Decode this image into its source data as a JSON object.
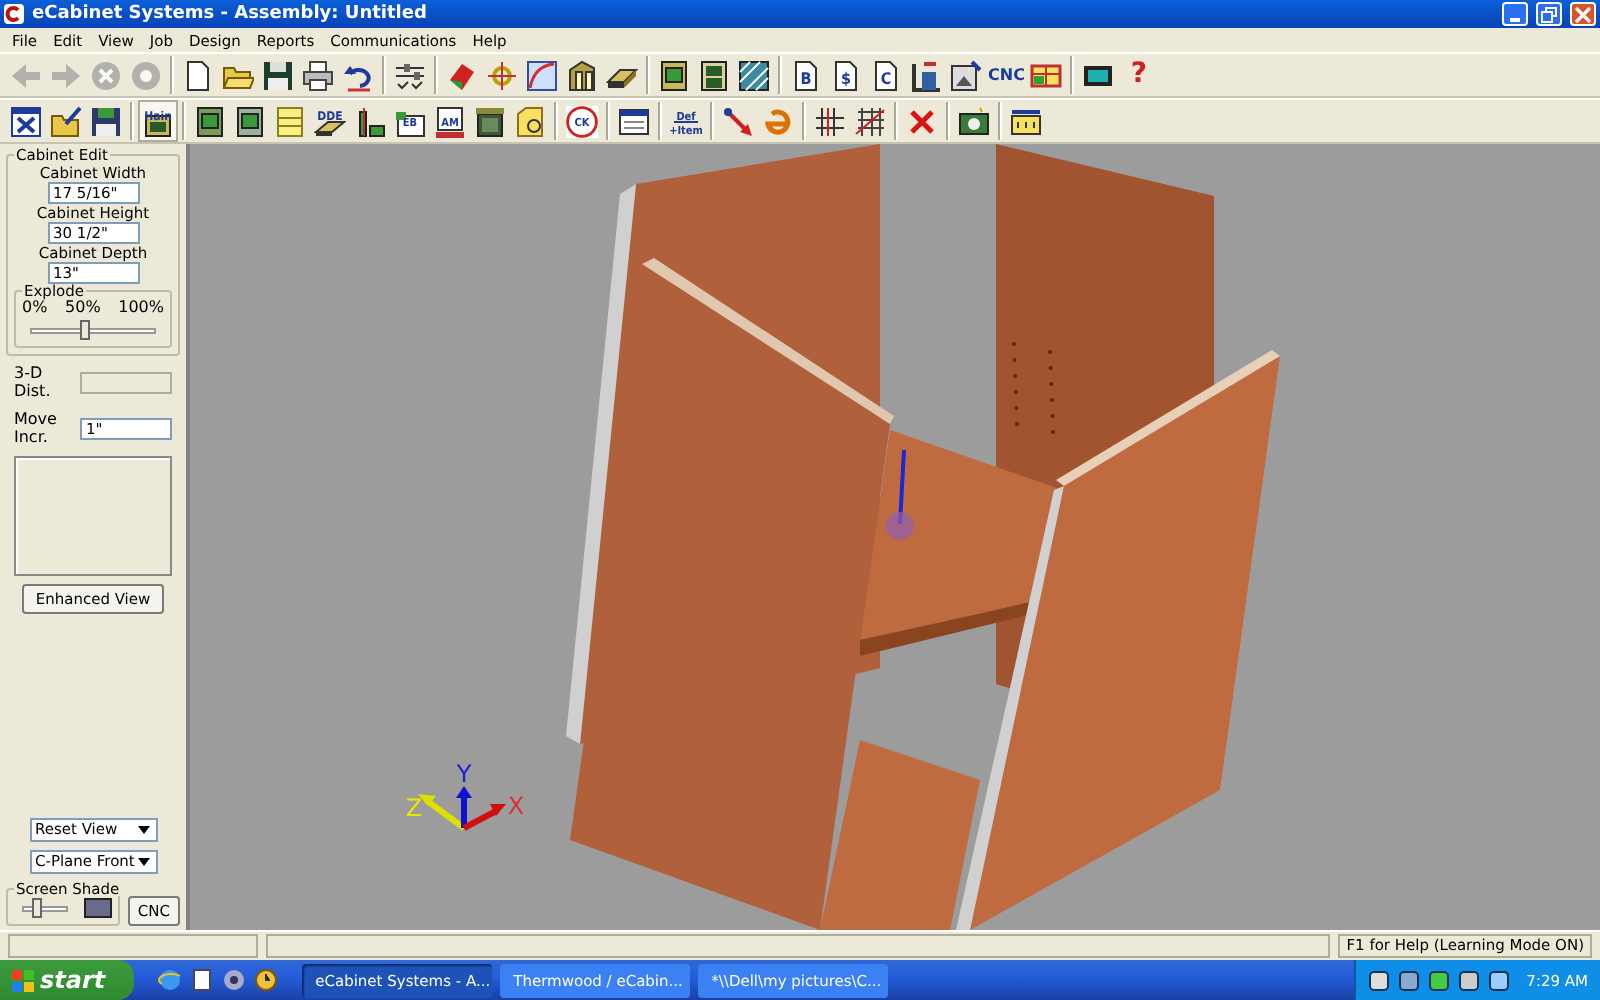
{
  "window": {
    "title": "eCabinet Systems - Assembly: Untitled"
  },
  "menu": [
    "File",
    "Edit",
    "View",
    "Job",
    "Design",
    "Reports",
    "Communications",
    "Help"
  ],
  "toolbar_1": [
    {
      "kind": "button",
      "disabled": true
    },
    {
      "kind": "button",
      "disabled": true
    },
    {
      "kind": "button",
      "disabled": true
    },
    {
      "kind": "button",
      "disabled": true
    },
    {
      "kind": "separator"
    },
    {
      "kind": "button",
      "disabled": false
    },
    {
      "kind": "button",
      "disabled": false
    },
    {
      "kind": "button",
      "disabled": false
    },
    {
      "kind": "button",
      "disabled": false
    },
    {
      "kind": "button",
      "disabled": false
    },
    {
      "kind": "separator"
    },
    {
      "kind": "button",
      "disabled": false
    },
    {
      "kind": "separator"
    },
    {
      "kind": "button",
      "disabled": false
    },
    {
      "kind": "button",
      "disabled": false
    },
    {
      "kind": "button",
      "disabled": false
    },
    {
      "kind": "button",
      "disabled": false
    },
    {
      "kind": "button",
      "disabled": false
    },
    {
      "kind": "separator"
    },
    {
      "kind": "button",
      "disabled": false
    },
    {
      "kind": "button",
      "disabled": false
    },
    {
      "kind": "button",
      "disabled": false
    },
    {
      "kind": "separator"
    },
    {
      "kind": "button",
      "disabled": false,
      "label": "B"
    },
    {
      "kind": "button",
      "disabled": false,
      "label": "$"
    },
    {
      "kind": "button",
      "disabled": false,
      "label": "C"
    },
    {
      "kind": "button",
      "disabled": false
    },
    {
      "kind": "button",
      "disabled": false
    },
    {
      "kind": "text",
      "disabled": false,
      "label": "CNC"
    },
    {
      "kind": "button",
      "disabled": false
    },
    {
      "kind": "separator"
    },
    {
      "kind": "button",
      "disabled": false
    },
    {
      "kind": "text",
      "disabled": false,
      "label": "?"
    }
  ],
  "toolbar_2": [
    {
      "kind": "button"
    },
    {
      "kind": "button"
    },
    {
      "kind": "button"
    },
    {
      "kind": "separator"
    },
    {
      "kind": "button",
      "label": "Hain",
      "selected": true
    },
    {
      "kind": "separator"
    },
    {
      "kind": "button"
    },
    {
      "kind": "button"
    },
    {
      "kind": "button"
    },
    {
      "kind": "button",
      "label": "DDE"
    },
    {
      "kind": "button"
    },
    {
      "kind": "button",
      "label": "EB"
    },
    {
      "kind": "button",
      "label": "AM"
    },
    {
      "kind": "button"
    },
    {
      "kind": "button"
    },
    {
      "kind": "separator"
    },
    {
      "kind": "button",
      "label": "CK"
    },
    {
      "kind": "separator"
    },
    {
      "kind": "button"
    },
    {
      "kind": "separator"
    },
    {
      "kind": "button",
      "label": "Def +Item"
    },
    {
      "kind": "separator"
    },
    {
      "kind": "button"
    },
    {
      "kind": "button"
    },
    {
      "kind": "separator"
    },
    {
      "kind": "button"
    },
    {
      "kind": "button"
    },
    {
      "kind": "separator"
    },
    {
      "kind": "button"
    },
    {
      "kind": "separator"
    },
    {
      "kind": "button"
    },
    {
      "kind": "separator"
    },
    {
      "kind": "button"
    }
  ],
  "left_panel": {
    "group_title": "Cabinet Edit",
    "fields": [
      {
        "label": "Cabinet Width",
        "value": "17 5/16\""
      },
      {
        "label": "Cabinet Height",
        "value": "30 1/2\""
      },
      {
        "label": "Cabinet Depth",
        "value": "13\""
      }
    ],
    "explode": {
      "title": "Explode",
      "ticks": [
        "0%",
        "50%",
        "100%"
      ],
      "level": 0.43
    },
    "dist": {
      "label": "3-D Dist.",
      "disabled": true
    },
    "move": {
      "label": "Move Incr.",
      "value": "1\""
    },
    "enhanced_button": "Enhanced View",
    "view_dropdown": "Reset View",
    "plane_dropdown": "C-Plane Front",
    "shade": {
      "title": "Screen Shade",
      "level": 0.3
    },
    "cnc_button": "CNC"
  },
  "viewport": {
    "axes": [
      "Z",
      "Y",
      "X"
    ]
  },
  "status_bar": [
    "F1 for Help (Learning Mode ON)"
  ],
  "taskbar": {
    "start": "start",
    "tasks": [
      {
        "label": "eCabinet Systems - A...",
        "selected": true
      },
      {
        "label": "Thermwood / eCabin...",
        "selected": false
      },
      {
        "label": "*\\\\Dell\\my  pictures\\C...",
        "selected": false
      }
    ],
    "clock": "7:29 AM"
  }
}
